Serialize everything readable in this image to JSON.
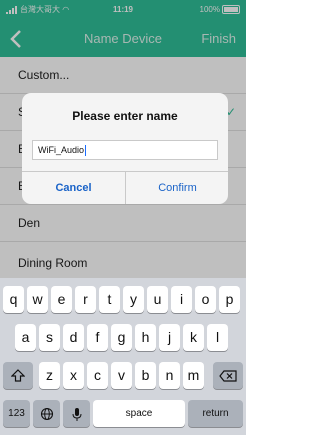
{
  "status_bar": {
    "carrier": "台灣大哥大",
    "time": "11:19",
    "battery": "100%"
  },
  "nav": {
    "title": "Name Device",
    "finish": "Finish"
  },
  "list": [
    "Custom...",
    "S",
    "B",
    "B",
    "Den",
    "Dining Room"
  ],
  "dialog": {
    "title": "Please enter name",
    "input_value": "WiFi_Audio",
    "cancel": "Cancel",
    "confirm": "Confirm"
  },
  "keyboard": {
    "row1": [
      "q",
      "w",
      "e",
      "r",
      "t",
      "y",
      "u",
      "i",
      "o",
      "p"
    ],
    "row2": [
      "a",
      "s",
      "d",
      "f",
      "g",
      "h",
      "j",
      "k",
      "l"
    ],
    "row3": [
      "z",
      "x",
      "c",
      "v",
      "b",
      "n",
      "m"
    ],
    "numbers": "123",
    "space": "space",
    "return": "return"
  },
  "colors": {
    "accent": "#2fbf98",
    "link": "#1a63c8"
  }
}
